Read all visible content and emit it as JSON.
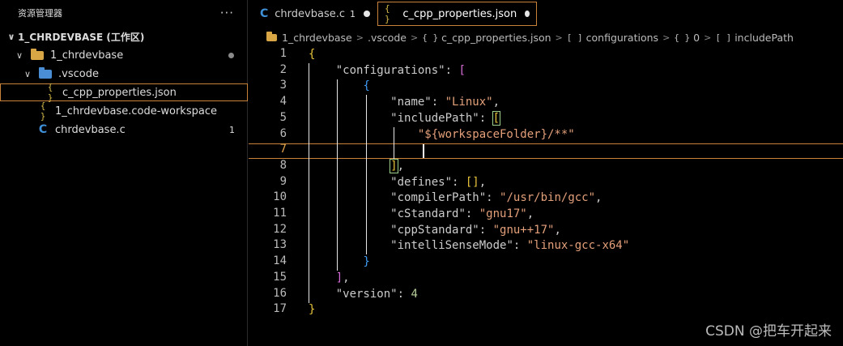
{
  "sidebar": {
    "title": "资源管理器",
    "more": "···",
    "items": [
      {
        "label": "1_CHRDEVBASE (工作区)",
        "chevron": "∨"
      },
      {
        "label": "1_chrdevbase",
        "chevron": "∨",
        "icon": "folder-yellow-icon"
      },
      {
        "label": ".vscode",
        "chevron": "∨",
        "icon": "folder-blue-icon"
      },
      {
        "label": "c_cpp_properties.json",
        "icon": "{ }"
      },
      {
        "label": "1_chrdevbase.code-workspace",
        "icon": "{ }"
      },
      {
        "label": "chrdevbase.c",
        "icon": "C",
        "badge": "1"
      }
    ]
  },
  "tabs": [
    {
      "label": "chrdevbase.c",
      "icon": "C",
      "count": "1"
    },
    {
      "label": "c_cpp_properties.json",
      "icon": "{ }"
    }
  ],
  "breadcrumb": {
    "items": [
      {
        "icon": "folder-icon",
        "label": "1_chrdevbase"
      },
      {
        "icon": "",
        "label": ".vscode"
      },
      {
        "icon": "{ }",
        "label": "c_cpp_properties.json"
      },
      {
        "icon": "[ ]",
        "label": "configurations"
      },
      {
        "icon": "{ }",
        "label": "0"
      },
      {
        "icon": "[ ]",
        "label": "includePath"
      }
    ],
    "separator": ">"
  },
  "editor": {
    "line_numbers": [
      "1",
      "2",
      "3",
      "4",
      "5",
      "6",
      "7",
      "8",
      "9",
      "10",
      "11",
      "12",
      "13",
      "14",
      "15",
      "16",
      "17"
    ],
    "current_line": 7
  },
  "code": {
    "configurations_key": "\"configurations\"",
    "name_key": "\"name\"",
    "name_val": "\"Linux\"",
    "include_key": "\"includePath\"",
    "include_val": "\"${workspaceFolder}/**\"",
    "defines_key": "\"defines\"",
    "compiler_key": "\"compilerPath\"",
    "compiler_val": "\"/usr/bin/gcc\"",
    "cstd_key": "\"cStandard\"",
    "cstd_val": "\"gnu17\"",
    "cppstd_key": "\"cppStandard\"",
    "cppstd_val": "\"gnu++17\"",
    "intelli_key": "\"intelliSenseMode\"",
    "intelli_val": "\"linux-gcc-x64\"",
    "version_key": "\"version\"",
    "version_val": "4"
  },
  "watermark": "CSDN @把车开起来",
  "colors": {
    "accent_border": "#c8823a",
    "string": "#e4a07a",
    "number": "#b7cf9a",
    "bracket_1": "#e8c53a",
    "bracket_2": "#d36ad6",
    "bracket_3": "#3f9cf5"
  }
}
